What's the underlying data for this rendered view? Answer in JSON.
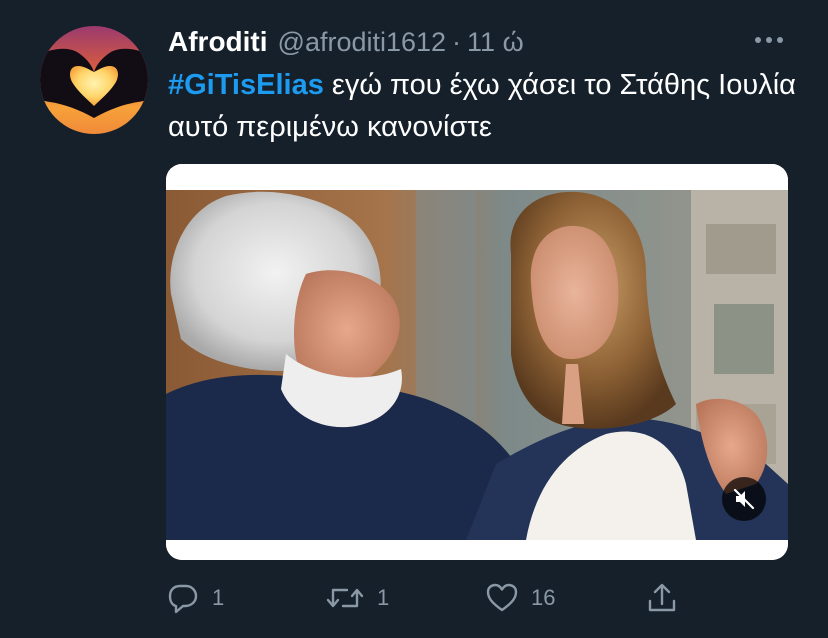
{
  "tweet": {
    "display_name": "Afroditi",
    "handle": "@afroditi1612",
    "separator": "·",
    "time": "11 ώ",
    "hashtag": "#GiTisElias",
    "text": " εγώ που έχω χάσει το Στάθης Ιουλία αυτό περιμένω κανονίστε",
    "more_icon": "more-horizontal-icon",
    "mute_icon": "muted-speaker-icon"
  },
  "actions": {
    "reply_count": "1",
    "retweet_count": "1",
    "like_count": "16",
    "reply_icon": "reply-icon",
    "retweet_icon": "retweet-icon",
    "like_icon": "heart-icon",
    "share_icon": "share-icon"
  },
  "colors": {
    "background": "#15202b",
    "accent": "#1d9bf0",
    "secondary_text": "#8b98a5"
  }
}
